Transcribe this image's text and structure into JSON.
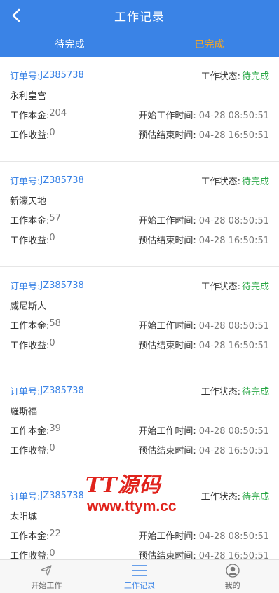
{
  "header": {
    "title": "工作记录"
  },
  "tabs": [
    {
      "label": "待完成"
    },
    {
      "label": "已完成"
    }
  ],
  "labels": {
    "order": "订单号:",
    "status": "工作状态:",
    "principal": "工作本金:",
    "income": "工作收益:",
    "start": "开始工作时间:",
    "end": "预估结束时间:"
  },
  "orders": [
    {
      "order_no": "JZ385738",
      "status": "待完成",
      "shop": "永利皇宫",
      "principal": "204",
      "income": "0",
      "start_time": "04-28 08:50:51",
      "end_time": "04-28 16:50:51"
    },
    {
      "order_no": "JZ385738",
      "status": "待完成",
      "shop": "新濠天地",
      "principal": "57",
      "income": "0",
      "start_time": "04-28 08:50:51",
      "end_time": "04-28 16:50:51"
    },
    {
      "order_no": "JZ385738",
      "status": "待完成",
      "shop": "威尼斯人",
      "principal": "58",
      "income": "0",
      "start_time": "04-28 08:50:51",
      "end_time": "04-28 16:50:51"
    },
    {
      "order_no": "JZ385738",
      "status": "待完成",
      "shop": "羅斯福",
      "principal": "39",
      "income": "0",
      "start_time": "04-28 08:50:51",
      "end_time": "04-28 16:50:51"
    },
    {
      "order_no": "JZ385738",
      "status": "待完成",
      "shop": "太阳城",
      "principal": "22",
      "income": "0",
      "start_time": "04-28 08:50:51",
      "end_time": "04-28 16:50:51"
    }
  ],
  "watermark": {
    "line1": "TT源码",
    "line2": "www.ttym.cc"
  },
  "tabbar": [
    {
      "label": "开始工作"
    },
    {
      "label": "工作记录"
    },
    {
      "label": "我的"
    }
  ]
}
